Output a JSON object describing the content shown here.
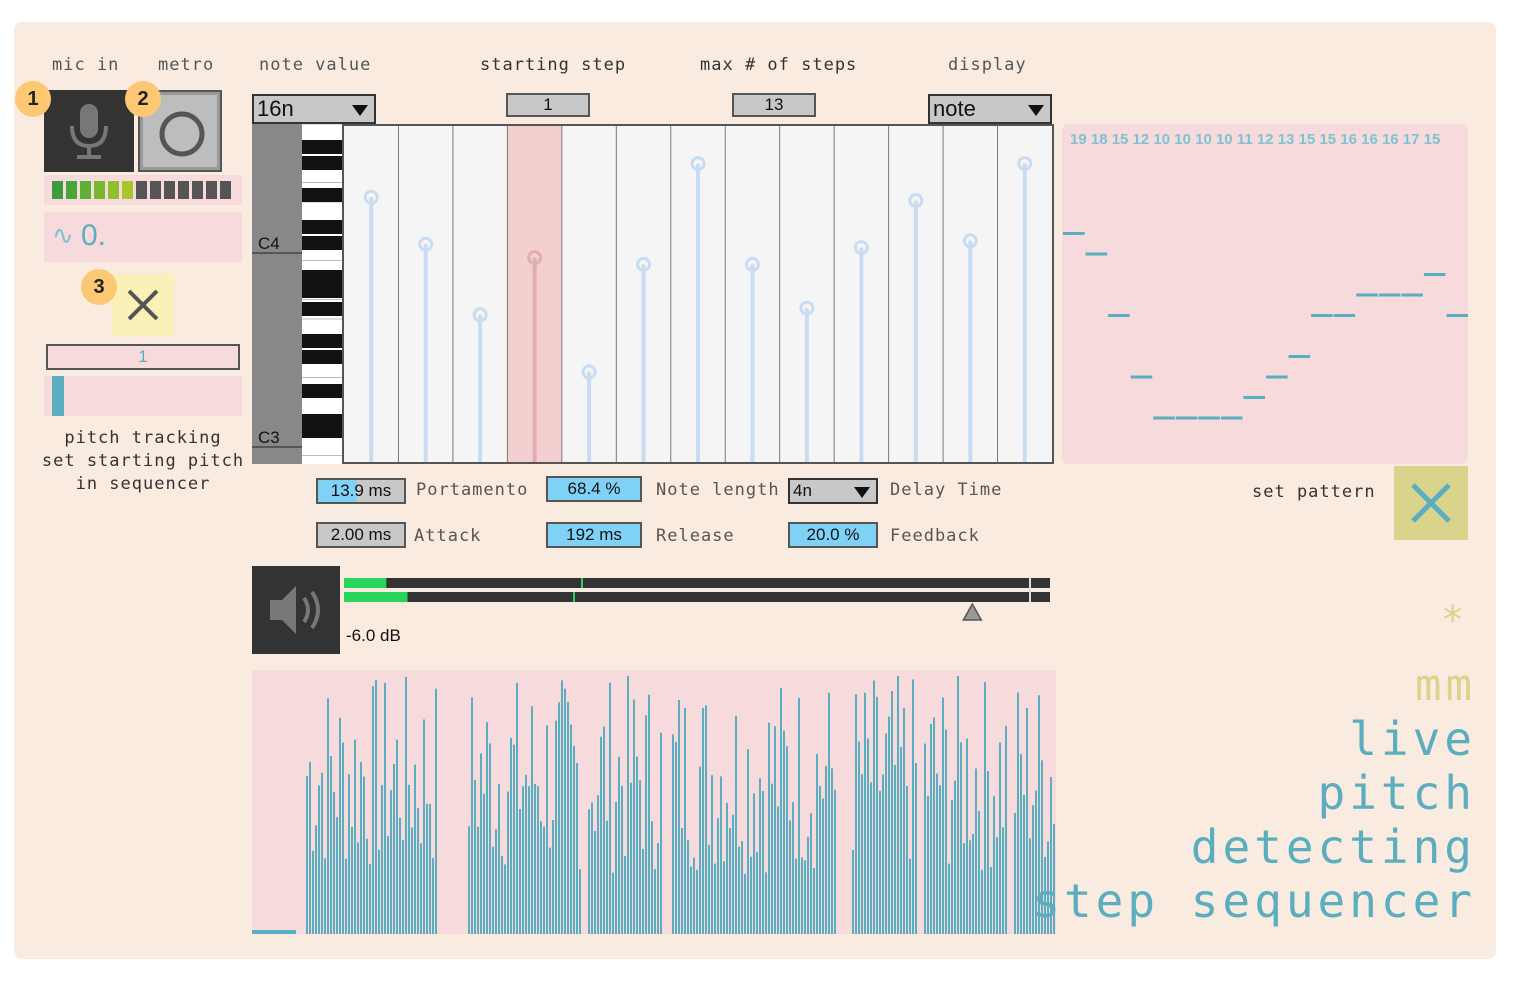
{
  "colors": {
    "panel": "#faebe0",
    "pink": "#f7dadb",
    "teal": "#5aaebf",
    "khaki": "#d9d38c",
    "yellow": "#fcc873",
    "dark": "#333333"
  },
  "labels": {
    "mic_in": "mic in",
    "metro": "metro",
    "note_value": "note value",
    "starting_step": "starting step",
    "max_steps": "max # of steps",
    "display": "display",
    "pitch_tracking": [
      "pitch tracking",
      "set starting pitch",
      "in sequencer"
    ],
    "set_pattern": "set pattern"
  },
  "badges": [
    "1",
    "2",
    "3"
  ],
  "icons": {
    "mic": "microphone-icon",
    "metro": "circle-toggle-icon",
    "close": "x-icon",
    "speaker": "speaker-icon",
    "wave": "tilde-icon"
  },
  "pitch_readout": "0.",
  "wave_symbol": "∿",
  "tracked_step": "1",
  "tracked_fraction": 0.12,
  "input_meter_levels": [
    1,
    1,
    1,
    1,
    1,
    1,
    0,
    0,
    0,
    0,
    0,
    0,
    0
  ],
  "note_value": {
    "selected": "16n"
  },
  "starting_step": {
    "value": "1"
  },
  "max_steps": {
    "value": "13"
  },
  "display_mode": {
    "selected": "note"
  },
  "keyboard": {
    "labels": [
      "C4",
      "C3"
    ]
  },
  "sequencer": {
    "steps": 13,
    "highlighted_step": 4,
    "values": [
      19,
      18,
      15,
      12,
      10,
      10,
      10,
      10,
      11,
      12,
      13,
      15,
      15,
      16,
      16,
      16,
      17,
      15
    ],
    "slider_levels": [
      0.8,
      0.66,
      0.45,
      0.62,
      0.28,
      0.6,
      0.9,
      0.6,
      0.47,
      0.65,
      0.79,
      0.67,
      0.9
    ]
  },
  "values_text": "19 18 15 12 10 10 10 10 11 12 13 15 15 16 16 16 17 15",
  "controls": {
    "portamento": {
      "value": "13.9 ms",
      "label": "Portamento",
      "fill": 0.45
    },
    "note_length": {
      "value": "68.4 %",
      "label": "Note length",
      "fill": 1.0
    },
    "delay_time": {
      "value": "4n",
      "label": "Delay Time"
    },
    "attack": {
      "value": "2.00 ms",
      "label": "Attack",
      "fill": 0.0
    },
    "release": {
      "value": "192 ms",
      "label": "Release",
      "fill": 1.0
    },
    "feedback": {
      "value": "20.0 %",
      "label": "Feedback",
      "fill": 1.0
    }
  },
  "output": {
    "gain_text": "-6.0 dB",
    "meter_top": 0.06,
    "meter_bottom": 0.09,
    "gain_fraction": 0.89
  },
  "title": {
    "star": "*",
    "lines": [
      "mm",
      "live",
      "pitch",
      "detecting",
      "step sequencer"
    ]
  }
}
